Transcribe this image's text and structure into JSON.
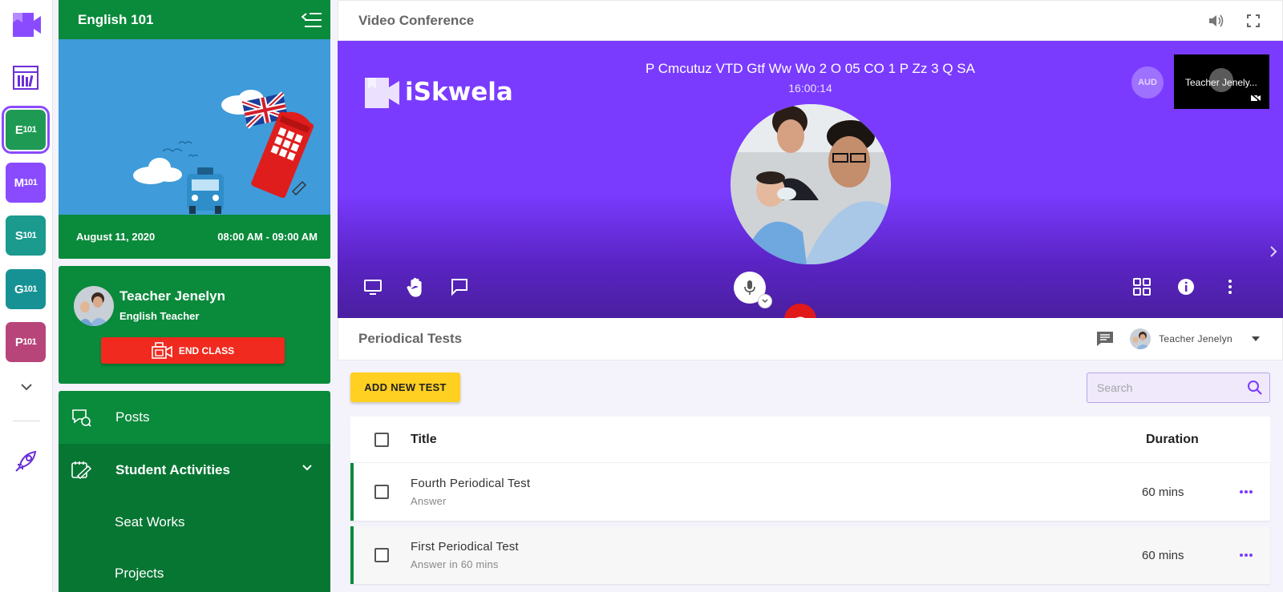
{
  "rail": {
    "courses": [
      {
        "letter": "E",
        "code": "101",
        "color": "#1f9a55",
        "active": true
      },
      {
        "letter": "M",
        "code": "101",
        "color": "#8a4bff",
        "active": false
      },
      {
        "letter": "S",
        "code": "101",
        "color": "#1b9a8e",
        "active": false
      },
      {
        "letter": "G",
        "code": "101",
        "color": "#179294",
        "active": false
      },
      {
        "letter": "P",
        "code": "101",
        "color": "#b8457a",
        "active": false
      }
    ]
  },
  "course": {
    "title": "English 101",
    "date": "August 11, 2020",
    "time": "08:00 AM - 09:00 AM"
  },
  "teacher": {
    "name": "Teacher Jenelyn",
    "role": "English Teacher",
    "end_class_label": "END CLASS"
  },
  "nav": {
    "posts": "Posts",
    "student_activities": "Student Activities",
    "seat_works": "Seat Works",
    "projects": "Projects"
  },
  "video": {
    "header_title": "Video Conference",
    "brand": "iSkwela",
    "room_code": "P Cmcutuz VTD Gtf Ww Wo 2 O 05 CO 1 P Zz 3 Q SA",
    "timer": "16:00:14",
    "aud_label": "AUD",
    "thumb_name": "Teacher Jenely..."
  },
  "tests": {
    "header_title": "Periodical Tests",
    "user_name": "Teacher Jenelyn",
    "add_label": "ADD NEW TEST",
    "search_placeholder": "Search",
    "col_title": "Title",
    "col_duration": "Duration",
    "rows": [
      {
        "name": "Fourth Periodical Test",
        "sub": "Answer",
        "duration": "60 mins"
      },
      {
        "name": "First Periodical Test",
        "sub": "Answer in 60 mins",
        "duration": "60 mins"
      }
    ]
  },
  "colors": {
    "brand_purple": "#7a3bff",
    "course_green": "#0a8a3b",
    "end_red": "#f02a1e",
    "add_yellow": "#ffcf21"
  }
}
